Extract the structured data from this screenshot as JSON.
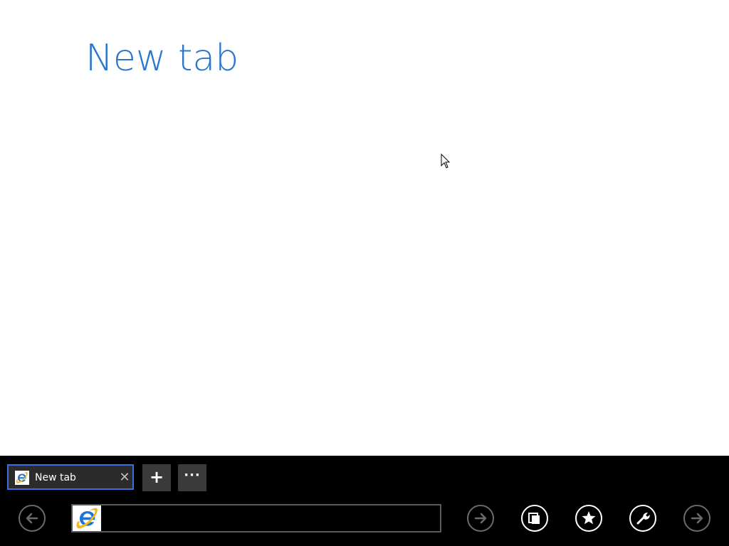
{
  "page": {
    "title": "New tab"
  },
  "tabbar": {
    "tabs": [
      {
        "label": "New tab",
        "favicon": "ie-icon",
        "active": true
      }
    ],
    "new_tab_label": "+",
    "more_label": "···",
    "close_glyph": "✕"
  },
  "navbar": {
    "address_value": "",
    "address_placeholder": "",
    "buttons": [
      "back-icon",
      "go-icon",
      "tabs-icon",
      "favorites-icon",
      "tools-icon",
      "forward-icon"
    ]
  },
  "colors": {
    "title_blue": "#2a76cf",
    "appbar_bg": "#000000",
    "tab_border": "#3a6fe0",
    "ie_blue": "#1e73d6",
    "ie_gold": "#f2b81d"
  }
}
